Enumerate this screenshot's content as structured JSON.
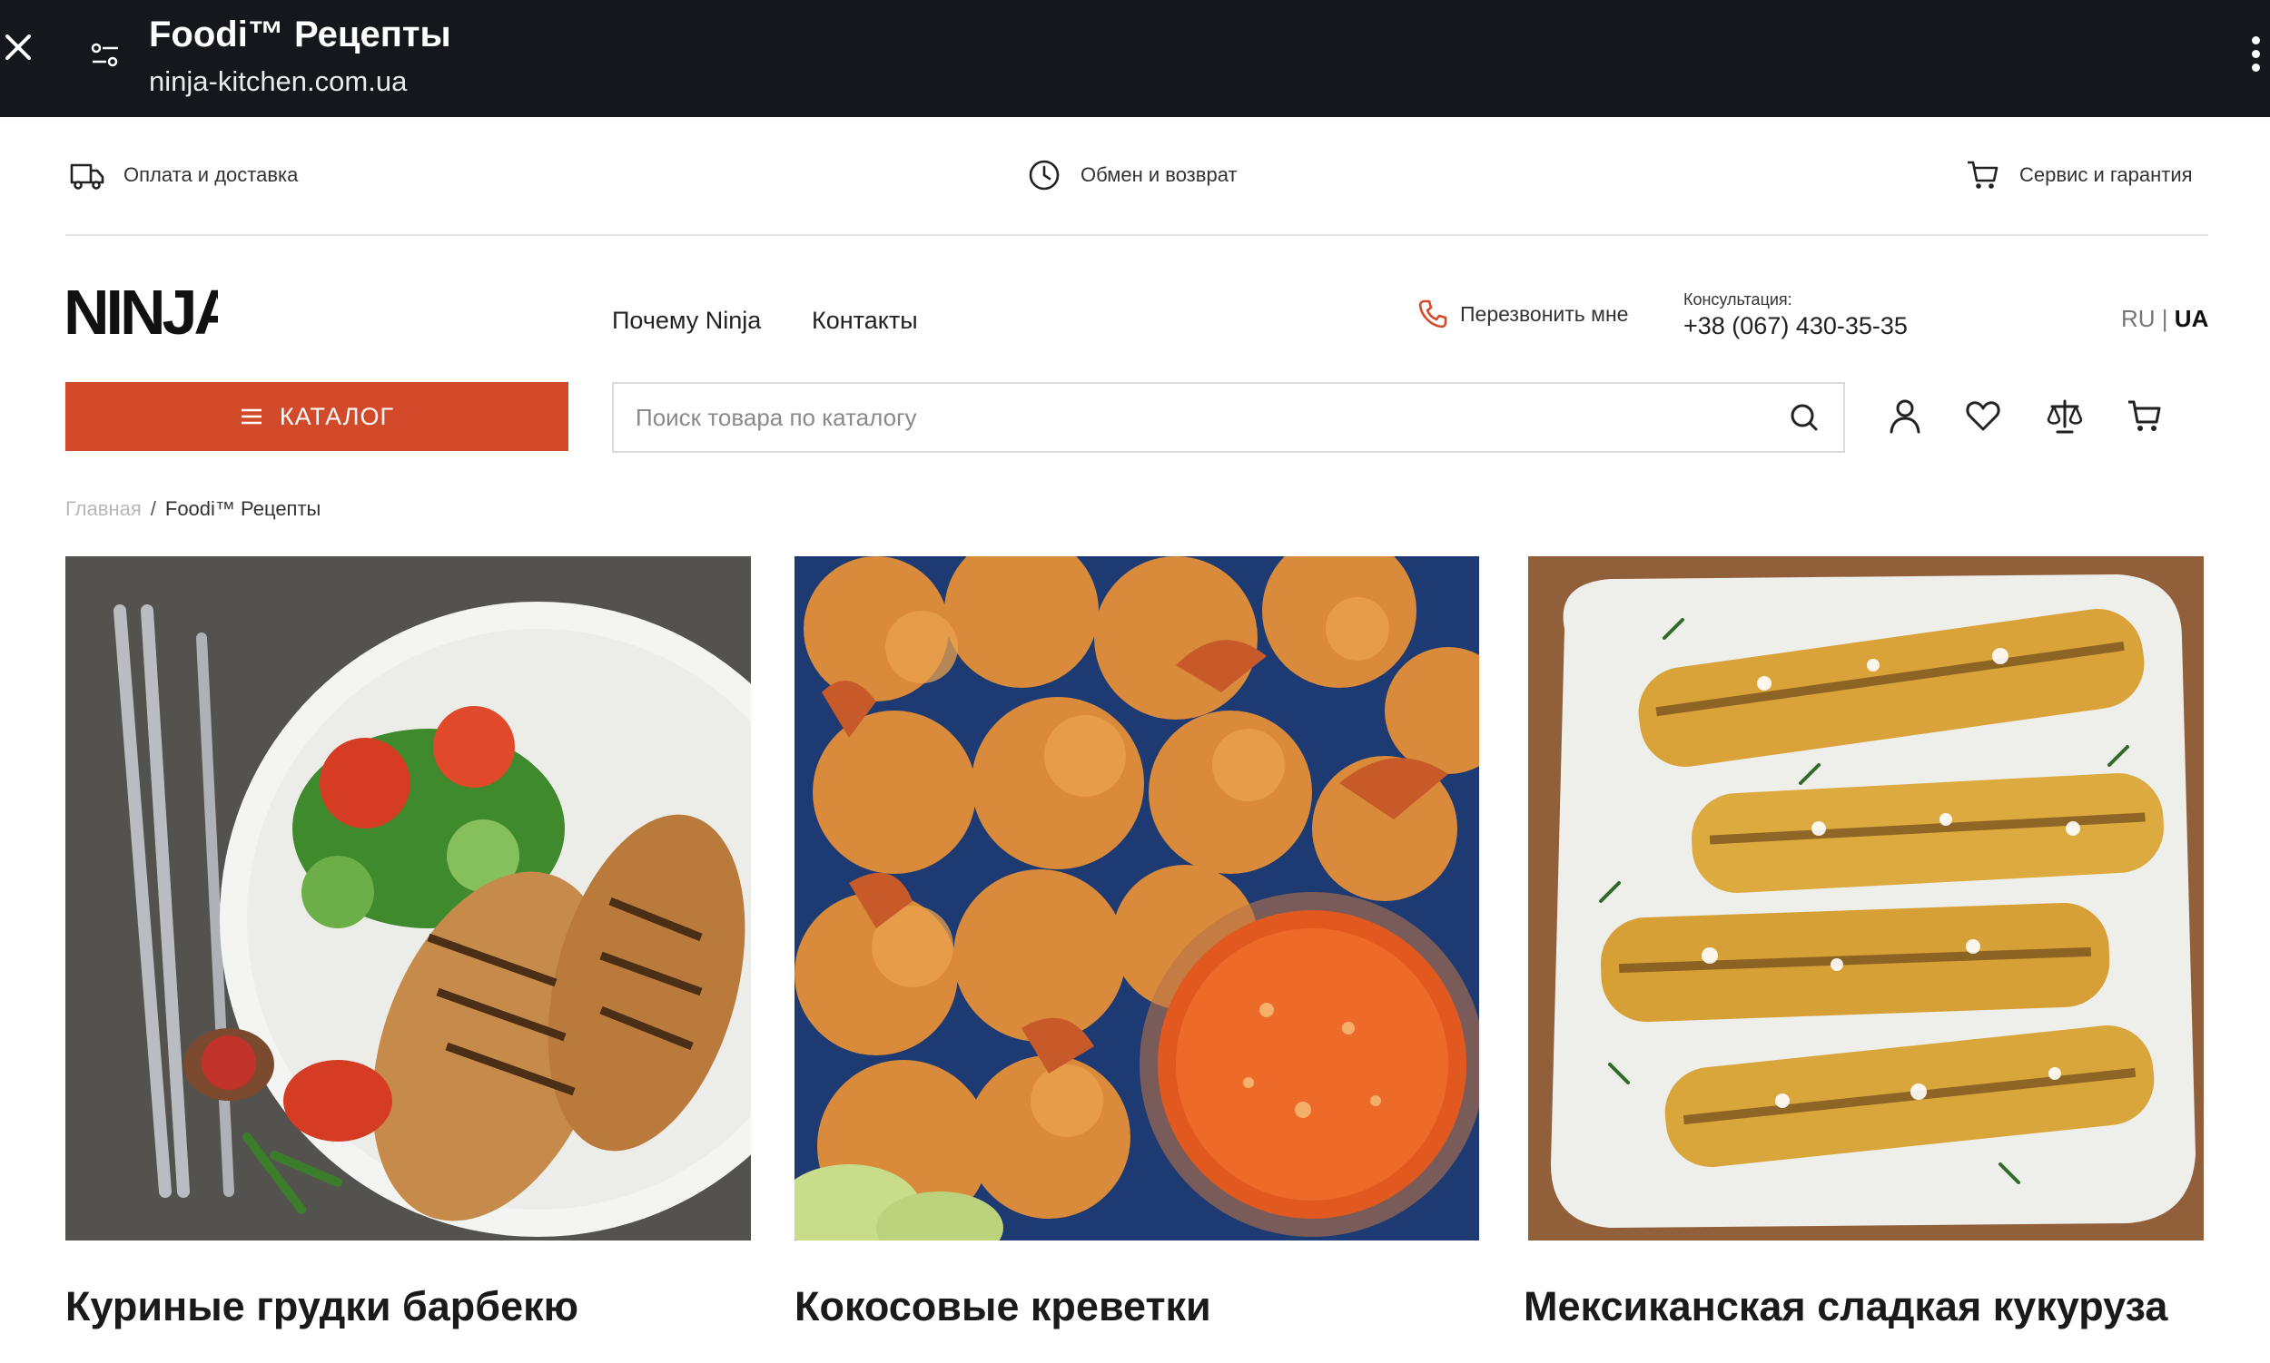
{
  "browser": {
    "title": "Foodi™ Рецепты",
    "url": "ninja-kitchen.com.ua"
  },
  "info_bar": {
    "delivery": "Оплата и доставка",
    "exchange": "Обмен и возврат",
    "service": "Сервис и гарантия"
  },
  "header": {
    "logo_text": "NINJA",
    "nav": [
      "Почему Ninja",
      "Контакты"
    ],
    "callback": "Перезвонить мне",
    "consult_label": "Консультация:",
    "phone": "+38 (067) 430-35-35",
    "lang_ru": "RU",
    "lang_sep": "|",
    "lang_ua": "UA"
  },
  "catalog_button": "КАТАЛОГ",
  "search": {
    "placeholder": "Поиск товара по каталогу"
  },
  "breadcrumb": {
    "home": "Главная",
    "sep": "/",
    "current": "Foodi™ Рецепты"
  },
  "recipes": [
    {
      "title": "Куриные грудки барбекю"
    },
    {
      "title": "Кокосовые креветки"
    },
    {
      "title": "Мексиканская сладкая кукуруза"
    }
  ],
  "colors": {
    "accent": "#d24a2a",
    "browser_bar": "#14181c"
  }
}
